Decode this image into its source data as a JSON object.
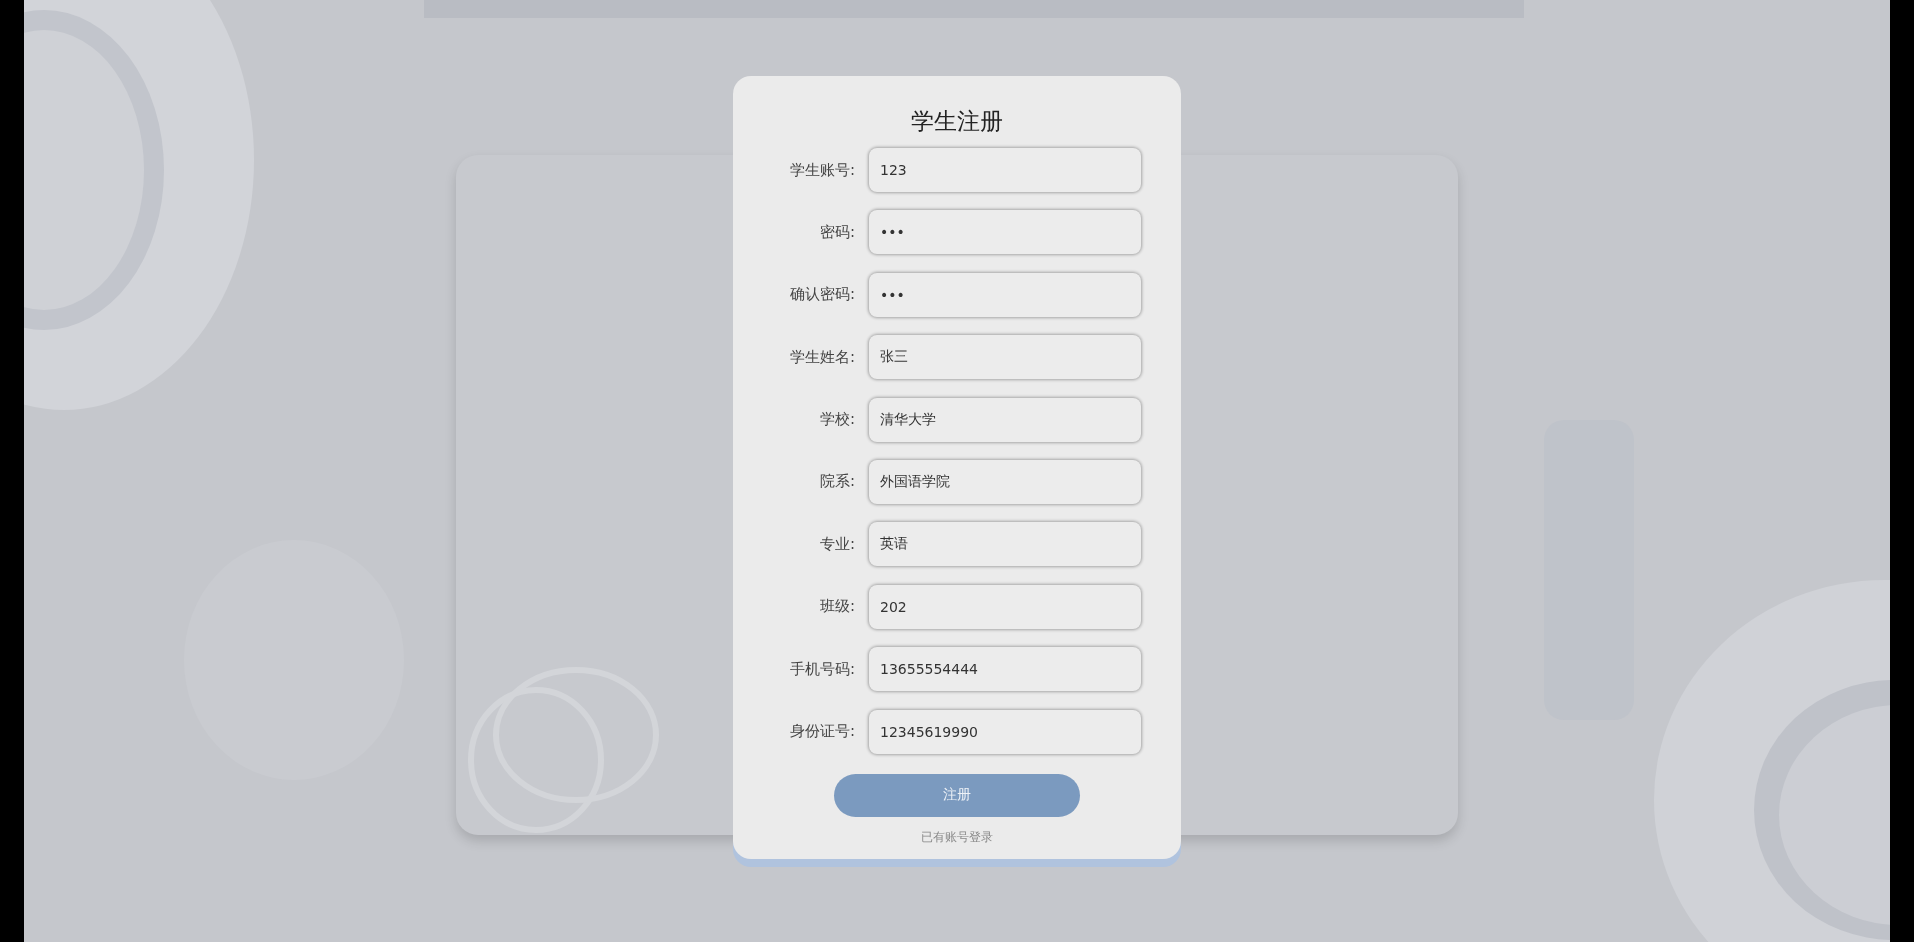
{
  "title": "学生注册",
  "fields": [
    {
      "label": "学生账号:",
      "value": "123"
    },
    {
      "label": "密码:",
      "value": "•••"
    },
    {
      "label": "确认密码:",
      "value": "•••"
    },
    {
      "label": "学生姓名:",
      "value": "张三"
    },
    {
      "label": "学校:",
      "value": "清华大学"
    },
    {
      "label": "院系:",
      "value": "外国语学院"
    },
    {
      "label": "专业:",
      "value": "英语"
    },
    {
      "label": "班级:",
      "value": "202"
    },
    {
      "label": "手机号码:",
      "value": "13655554444"
    },
    {
      "label": "身份证号:",
      "value": "12345619990"
    }
  ],
  "submit": "注册",
  "login_link": "已有账号登录"
}
